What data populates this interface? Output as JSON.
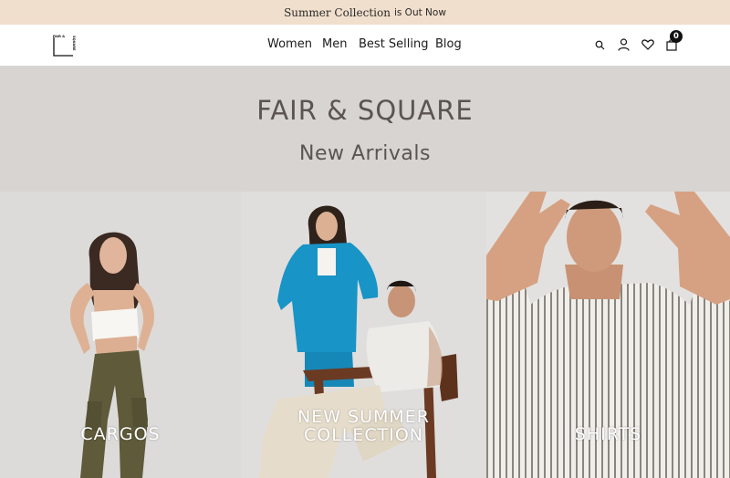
{
  "announcement": {
    "highlight": "Summer Collection",
    "text": "is Out Now"
  },
  "header": {
    "logo_text": "FAIR & SQUARE",
    "nav": [
      "Women",
      "Men",
      "Best Selling",
      "Blog"
    ],
    "icons": [
      "search-icon",
      "account-icon",
      "heart-icon",
      "bag-icon"
    ],
    "cart_count": "0"
  },
  "hero": {
    "brand": "FAIR & SQUARE",
    "subtitle": "New Arrivals"
  },
  "tiles": [
    {
      "label": "CARGOS"
    },
    {
      "label_line1": "NEW SUMMER",
      "label_line2": "COLLECTION"
    },
    {
      "label": "SHIRTS"
    }
  ],
  "colors": {
    "announcement_bg": "#f0dfcc",
    "hero_bg": "#d7d4d1",
    "hero_text": "#5b5450"
  }
}
